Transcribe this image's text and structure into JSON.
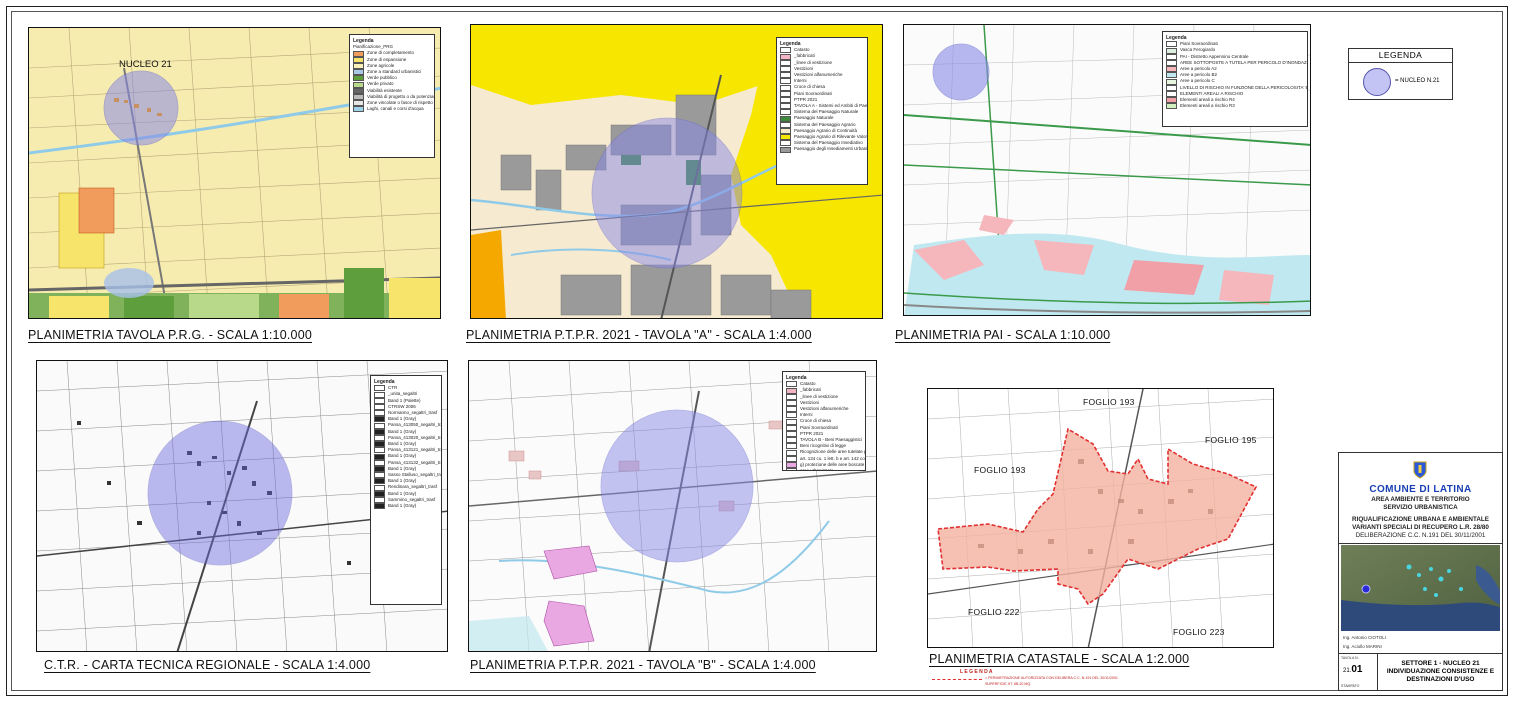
{
  "legend": {
    "title": "LEGENDA",
    "nucleo_label": "= NUCLEO N.21"
  },
  "maps": {
    "prg": {
      "caption": "PLANIMETRIA TAVOLA P.R.G. - SCALA 1:10.000",
      "nucleo": "NUCLEO 21",
      "legend": {
        "title": "Legenda",
        "subtitle": "Pianificazione_PRG",
        "items": [
          {
            "label": "Zone di completamento",
            "color": "#f19b5c"
          },
          {
            "label": "Zone di espansione",
            "color": "#f7e46a"
          },
          {
            "label": "Zone agricole",
            "color": "#f8f2b8"
          },
          {
            "label": "Zone a standard urbanistici",
            "color": "#a8c8e8"
          },
          {
            "label": "Verde pubblico",
            "color": "#5e9e3c"
          },
          {
            "label": "Verde privato",
            "color": "#b9d98a"
          },
          {
            "label": "Viabilità esistente",
            "color": "#666666"
          },
          {
            "label": "Viabilità di progetto o da potenziare",
            "color": "#bbbbbb"
          },
          {
            "label": "Zone vincolate o fasce di rispetto",
            "color": "#e6e6e6"
          },
          {
            "label": "Laghi, canali e corsi d'acqua",
            "color": "#9ed3ea"
          }
        ]
      }
    },
    "ptpr_a": {
      "caption": "PLANIMETRIA P.T.P.R. 2021 - TAVOLA \"A\" - SCALA 1:4.000",
      "legend": {
        "title": "Legenda",
        "items": [
          {
            "label": "Catasto",
            "color": "#ffffff"
          },
          {
            "label": "_fabbricati",
            "color": "#f3b5c4"
          },
          {
            "label": "_linee di vestizione",
            "color": "#ffffff"
          },
          {
            "label": "Vestizioni",
            "color": "#ffffff"
          },
          {
            "label": "Vestizioni alfanumeriche",
            "color": "#ffffff"
          },
          {
            "label": "Interni",
            "color": "#ffffff"
          },
          {
            "label": "Croce di chiesa",
            "color": "#ffffff"
          },
          {
            "label": "Piani Sovraordinati",
            "color": "#ffffff"
          },
          {
            "label": "PTPR 2021",
            "color": "#ffffff"
          },
          {
            "label": "TAVOLA A - Sistemi ed Ambiti di Paesaggio",
            "color": "#ffffff"
          },
          {
            "label": "Sistema del Paesaggio Naturale",
            "color": "#ffffff"
          },
          {
            "label": "Paesaggio Naturale",
            "color": "#3d8a3a"
          },
          {
            "label": "Sistema del Paesaggio Agrario",
            "color": "#ffffff"
          },
          {
            "label": "Paesaggio Agrario di Continuità",
            "color": "#f7ecc8"
          },
          {
            "label": "Paesaggio Agrario di Rilevante Valore",
            "color": "#f7e600"
          },
          {
            "label": "Sistema del Paesaggio Insediativo",
            "color": "#ffffff"
          },
          {
            "label": "Paesaggio degli Insediamenti Urbani",
            "color": "#9a9a9a"
          }
        ]
      }
    },
    "pai": {
      "caption": "PLANIMETRIA PAI - SCALA 1:10.000",
      "legend": {
        "title": "Legenda",
        "items": [
          {
            "label": "Piani Sovraordinati",
            "color": "#ffffff"
          },
          {
            "label": "Vasca Ferogiardo",
            "color": "#e0f0e0"
          },
          {
            "label": "PAI - Distretto Appennino Centrale",
            "color": "#ffffff"
          },
          {
            "label": "AREE SOTTOPOSTE A TUTELA PER PERICOLO D'INONDAZIONE",
            "color": "#ffffff"
          },
          {
            "label": "Aree a pericolo A2",
            "color": "#f5b6bc"
          },
          {
            "label": "Aree a pericolo B2",
            "color": "#c0e8f0"
          },
          {
            "label": "Aree a pericolo C",
            "color": "#e8f8e0"
          },
          {
            "label": "LIVELLO DI RISCHIO IN FUNZIONE DELLA PERICOLOSITA' E DEL VALORE ESPOSTO",
            "color": "#ffffff"
          },
          {
            "label": "ELEMENTI AREALI A RISCHIO",
            "color": "#ffffff"
          },
          {
            "label": "Elementi areali a rischio R4",
            "color": "#f2a0a8"
          },
          {
            "label": "Elementi areali a rischio R3",
            "color": "#d4f0c0"
          }
        ]
      }
    },
    "ctr": {
      "caption": "C.T.R. - CARTA TECNICA REGIONALE - SCALA 1:4.000",
      "legend": {
        "title": "Legenda",
        "items": [
          {
            "label": "CTR",
            "color": "#ffffff"
          },
          {
            "label": "_unita_segaltri",
            "color": "#ffffff"
          },
          {
            "label": "Band 1 (Palette)",
            "color": "#ffffff"
          },
          {
            "label": "CTRSW 2006",
            "color": "#ffffff"
          },
          {
            "label": "Normanno_segaltri_trasf",
            "color": "#ffffff"
          },
          {
            "label": "Band 1 (Gray)",
            "color": "#222222"
          },
          {
            "label": "Pansa_413050_segaltri_trasf",
            "color": "#ffffff"
          },
          {
            "label": "Band 1 (Gray)",
            "color": "#222222"
          },
          {
            "label": "Pansa_413020_segaltri_trasf",
            "color": "#ffffff"
          },
          {
            "label": "Band 1 (Gray)",
            "color": "#222222"
          },
          {
            "label": "Pansa_413121_segaltri_trasf",
            "color": "#ffffff"
          },
          {
            "label": "Band 1 (Gray)",
            "color": "#222222"
          },
          {
            "label": "Pansa_413132_segaltri_trasf",
            "color": "#ffffff"
          },
          {
            "label": "Band 1 (Gray)",
            "color": "#222222"
          },
          {
            "label": "Sasso Stalluso_segaltri_trasf",
            "color": "#ffffff"
          },
          {
            "label": "Band 1 (Gray)",
            "color": "#222222"
          },
          {
            "label": "Rendinara_segaltri_trasf",
            "color": "#ffffff"
          },
          {
            "label": "Band 1 (Gray)",
            "color": "#222222"
          },
          {
            "label": "Sammino_segaltri_trasf",
            "color": "#ffffff"
          },
          {
            "label": "Band 1 (Gray)",
            "color": "#222222"
          }
        ]
      }
    },
    "ptpr_b": {
      "caption": "PLANIMETRIA P.T.P.R. 2021 - TAVOLA \"B\" - SCALA 1:4.000",
      "legend": {
        "title": "Legenda",
        "items": [
          {
            "label": "Catasto",
            "color": "#ffffff"
          },
          {
            "label": "_fabbricati",
            "color": "#f3b5c4"
          },
          {
            "label": "_linee di vestizione",
            "color": "#ffffff"
          },
          {
            "label": "Vestizioni",
            "color": "#ffffff"
          },
          {
            "label": "Vestizioni alfanumeriche",
            "color": "#ffffff"
          },
          {
            "label": "Interni",
            "color": "#ffffff"
          },
          {
            "label": "Croce di chiesa",
            "color": "#ffffff"
          },
          {
            "label": "Piani Sovraordinati",
            "color": "#ffffff"
          },
          {
            "label": "PTPR 2021",
            "color": "#ffffff"
          },
          {
            "label": "TAVOLA B - Beni Paesaggistici",
            "color": "#ffffff"
          },
          {
            "label": "Beni ricognitivi di legge",
            "color": "#ffffff"
          },
          {
            "label": "Ricognizione delle aree tutelate per legge",
            "color": "#ffffff"
          },
          {
            "label": "art. 134 co. 1 lett. b e art. 142 co. 1 D.Lgs. 42/2004",
            "color": "#ffffff"
          },
          {
            "label": "g) protezione delle aree boscate",
            "color": "#e9a8e2"
          },
          {
            "label": "aree urbanizzate",
            "color": "#ffffff"
          }
        ]
      }
    },
    "catastale": {
      "caption": "PLANIMETRIA CATASTALE - SCALA 1:2.000",
      "fogli": [
        "FOGLIO 193",
        "FOGLIO 195",
        "FOGLIO 193",
        "FOGLIO 222",
        "FOGLIO 223"
      ],
      "legend_title": "L E G E N D A",
      "legend_text": "= PERIMETRAZIONE AUTORIZZATA CON DELIBERA C.C. N.191 DEL 30/11/2001",
      "legend_sub": "SUPERFICIE HT. 6B.20 MQ."
    }
  },
  "title_block": {
    "comune": "COMUNE DI LATINA",
    "area": "AREA AMBIENTE E TERRITORIO",
    "servizio": "SERVIZIO URBANISTICA",
    "riqualificazione": "RIQUALIFICAZIONE URBANA E AMBIENTALE",
    "varianti": "VARIANTI SPECIALI DI RECUPERO L.R. 28/80",
    "delibera": "DELIBERAZIONE C.C. N.191 DEL 30/11/2001",
    "eng1": "Ing. Antonio CIOTOLI",
    "eng2": "Ing. Aciollo MARINI",
    "num_label": "TAVOLA N.",
    "num_prefix": "21.",
    "num": "01",
    "num_sub": "STAMPATO",
    "settore": "SETTORE 1 - NUCLEO 21",
    "desc": "INDIVIDUAZIONE CONSISTENZE E DESTINAZIONI D'USO"
  },
  "colors": {
    "nucleo_fill": "#8a8ae8",
    "catastale_fill": "#f4b0a0",
    "catastale_line": "#e03030",
    "comune_blue": "#1a3fb5"
  }
}
